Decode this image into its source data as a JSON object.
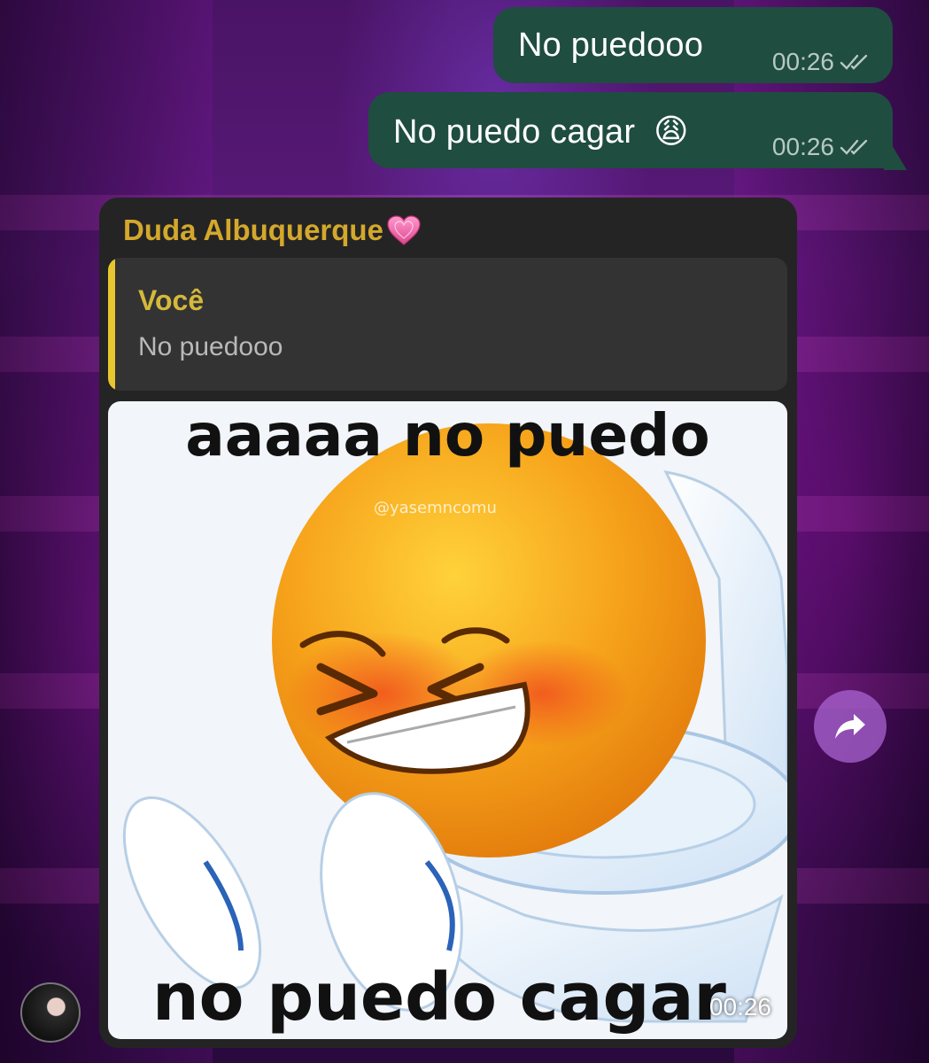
{
  "messages": {
    "outgoing": [
      {
        "text": "No puedooo",
        "time": "00:26"
      },
      {
        "text": "No puedo cagar",
        "emoji": "😩",
        "time": "00:26"
      }
    ],
    "incoming": {
      "sender": "Duda Albuquerque",
      "sender_emoji": "heart-icon",
      "reply": {
        "author": "Você",
        "text": "No puedooo"
      },
      "image": {
        "top_caption": "aaaaa no puedo",
        "bottom_caption": "no puedo cagar",
        "watermark": "@yasemncomu"
      },
      "time": "00:26"
    }
  },
  "colors": {
    "outgoing_bubble": "#1f4d40",
    "incoming_bubble": "#242424",
    "sender_name": "#d4a82c",
    "reply_bar": "#e6c72f",
    "forward_button": "#aa64d2"
  },
  "icons": {
    "read_receipt": "double-check-icon",
    "forward": "forward-arrow-icon"
  }
}
